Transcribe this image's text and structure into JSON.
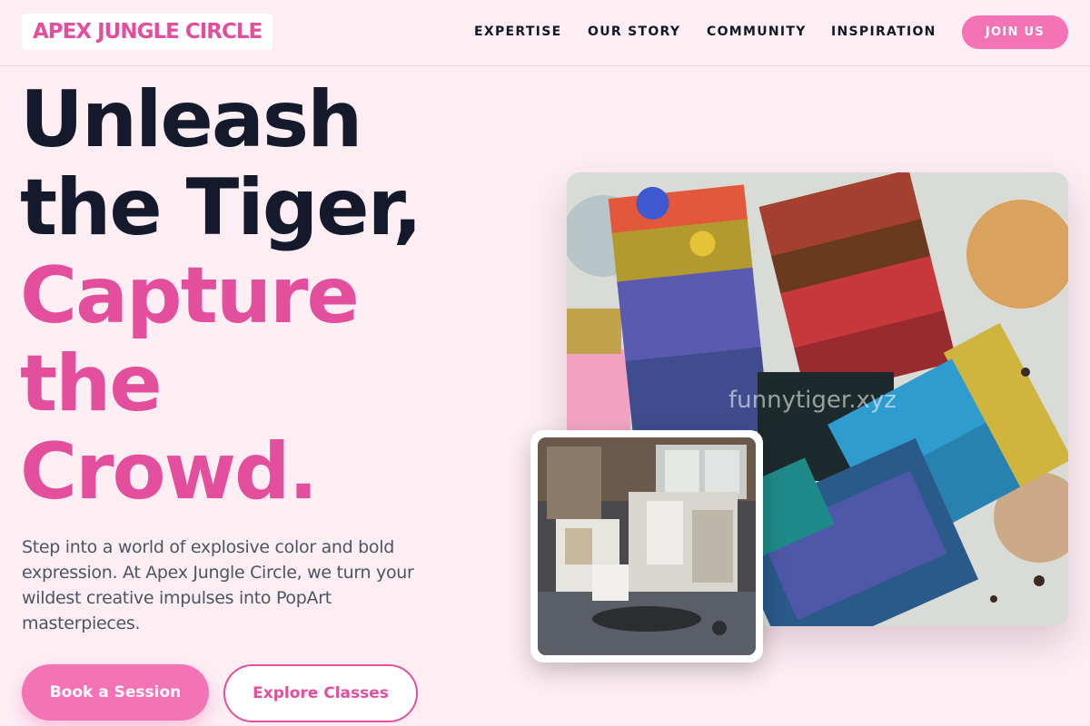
{
  "header": {
    "logo_text": "APEX JUNGLE CIRCLE",
    "nav": [
      "EXPERTISE",
      "OUR STORY",
      "COMMUNITY",
      "INSPIRATION"
    ],
    "cta_label": "JOIN US"
  },
  "hero": {
    "headline_lines": [
      "Unleash",
      "the Tiger,",
      "Capture",
      "the",
      "Crowd."
    ],
    "intro": "Step into a world of explosive color and bold expression. At Apex Jungle Circle, we turn your wildest creative impulses into PopArt masterpieces.",
    "primary_button": "Book a Session",
    "secondary_button": "Explore Classes"
  },
  "media": {
    "main_image_watermark": "funnytiger.xyz"
  },
  "colors": {
    "background": "#fdeef4",
    "brand_pink": "#e34e9d",
    "button_pink": "#f472b6",
    "headline_dark": "#141a2b"
  }
}
